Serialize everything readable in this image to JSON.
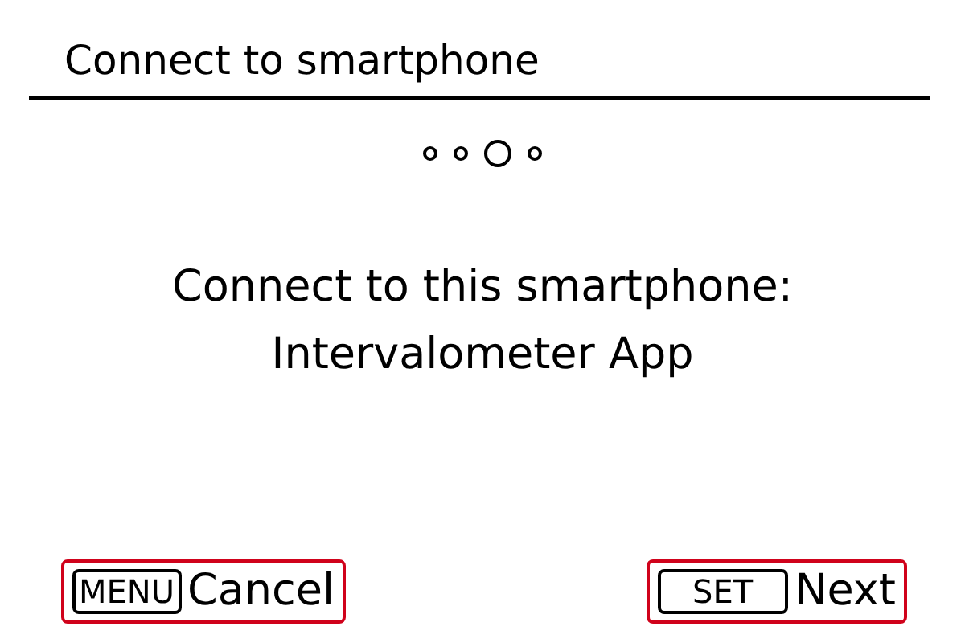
{
  "title": "Connect to smartphone",
  "steps": [
    {
      "selected": false
    },
    {
      "selected": false
    },
    {
      "selected": true
    },
    {
      "selected": false
    }
  ],
  "message": [
    "Connect to this smartphone:",
    "Intervalometer App"
  ],
  "buttons": [
    {
      "key": "MENU",
      "label": "Cancel"
    },
    {
      "key": "SET",
      "label": "Next"
    }
  ]
}
